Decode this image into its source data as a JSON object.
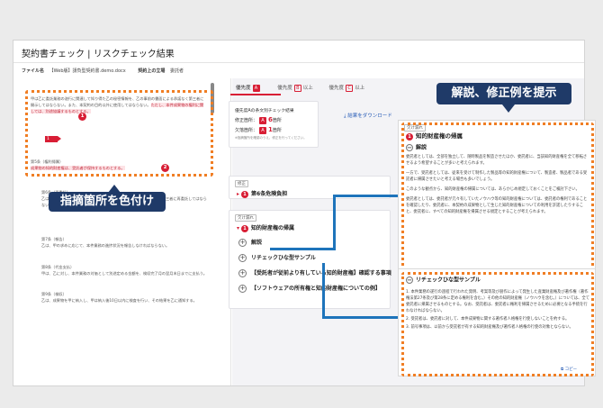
{
  "window": {
    "title": "契約書チェック | リスクチェック結果",
    "file_label": "ファイル名",
    "file_value": "【Web版】請負型契約書.demo.docx",
    "position_label": "契約上の立場",
    "position_value": "委託者"
  },
  "document": {
    "block1_text": "甲は乙に委託業務の遂行に関連して知り得た乙の秘密情報を、乙の事前の書面による承諾なく第三者に開示してはならない。また、本契約の目的以外に使用してはならない。",
    "block1_highlight": "ただし、本件成果物の権利に関しては、別途協議するものとする。",
    "block2_title": "第5条（権利帰属）",
    "block2_highlight": "成果物の知的財産権は、受託者が保持するものとする。",
    "block3_title": "第6条（再委託）",
    "block3_text": "乙は、甲の事前の書面による承諾を得ずに、本件業務の全部又は一部を第三者に再委託してはならない。",
    "block4_title": "第7条（報告）",
    "block4_text": "乙は、甲の求めに応じて、本件業務の進捗状況を報告しなければならない。",
    "block5_title": "第8条（代金支払）",
    "block5_text": "甲は、乙に対し、本件業務の対価として別途定める金額を、検収完了月の翌月末日までに支払う。",
    "block6_title": "第9条（検収）",
    "block6_text": "乙は、成果物を甲に納入し、甲は納入後10日以内に検査を行い、その結果を乙に通知する。"
  },
  "markers": {
    "m1": "1",
    "m2": "2",
    "flag": "1"
  },
  "callouts": {
    "left": "指摘箇所を色付け",
    "right": "解説、修正例を提示"
  },
  "right_pane": {
    "tab1_prefix": "優先度",
    "tab1_level": "A",
    "tab2_prefix": "優先度",
    "tab2_level": "B",
    "tab2_suffix": "以上",
    "tab3_prefix": "優先度",
    "tab3_level": "C",
    "tab3_suffix": "以上",
    "summary_title": "優先度Aの条文別チェック結果",
    "row1_label": "修正箇所：",
    "row1_level": "A",
    "row1_count": "6",
    "row1_unit": "箇所",
    "row2_label": "欠落箇所：",
    "row2_level": "A",
    "row2_count": "1",
    "row2_unit": "箇所",
    "summary_note": "※指摘箇所を確認のうえ、修正を行ってください。",
    "download": "結果をダウンロード",
    "sec1_tag": "修正",
    "sec1_title": "第6条危険負担",
    "sec2_tag": "欠け漏れ",
    "sec2_title": "知的財産権の帰属",
    "exp1": "解説",
    "exp2": "リチェックひな型サンプル",
    "exp3": "【受託者が従前より有している知的財産権】確認する事項",
    "exp4": "【ソフトウェアの所有権と知的財産権についての例】"
  },
  "popup1": {
    "tag": "欠け漏れ",
    "num": "1",
    "title": "知的財産権の帰属",
    "section": "解説",
    "p1": "委託者としては、全部を独立して、随時製品を製造させたほか、委託者に、当該知的財産権を全て移転させるよう希望することが多いと考えられます。",
    "p2": "一方で、受託者としては、従来を受けて制作した製品等の知的財産権について、製造者、製品者である受託者に帰属させたいと考える場合も多いでしょう。",
    "p3": "このような観点から、知的財産権の帰属については、あらかじめ規定しておくことをご検討下さい。",
    "p4": "委託者としては、委託者が元々有していたノウハウ等の知的財産権については、委託者の権利であることを確認したり、委託者に、本契約の成果物として生じた知的財産権についての利用を許諾したりすること、委託者に、すべての知的財産権を帰属させる規定とすることが考えられます。"
  },
  "popup2": {
    "title": "リチェックひな型サンプル",
    "p1": "1. 本件業務の遂行の過程で行われた発明、考案等及び創作によって発生した産業財産権及び著作権（著作権法第27条及び第28条に定める権利を含む。）その他の知的財産権（ノウハウを含む。）については、全て委託者に帰属させるものとする。なお、受託者は、委託者に権利を帰属させるために必要となる手続を行わなければならない。",
    "p2": "2. 受託者は、委託者に対して、本件成果物に関する著作者人格権を行使しないことを約する。",
    "p3": "3. 前号事項は、以前から受託者が有する知的財産権及び著作者人格権の行使の対象とならない。",
    "copy": "コピー"
  }
}
